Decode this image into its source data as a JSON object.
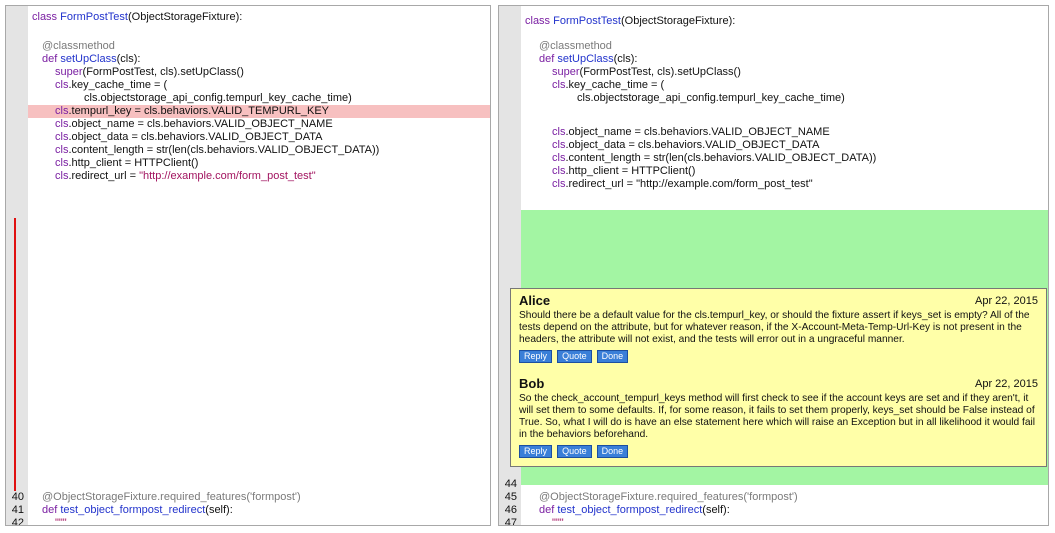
{
  "left": {
    "code": {
      "class_kw": "class",
      "class_name": "FormPostTest",
      "class_rest": "(ObjectStorageFixture):",
      "decorator": "@classmethod",
      "def_kw": "def",
      "setup_fn": "setUpClass",
      "setup_args": "(cls):",
      "super_kw": "super",
      "super_rest": "(FormPostTest, cls).setUpClass()",
      "cls": "cls",
      "key_cache": ".key_cache_time = (",
      "key_cache_cont": "cls.objectstorage_api_config.tempurl_key_cache_time)",
      "tempurl": ".tempurl_key = cls.behaviors.VALID_TEMPURL_KEY",
      "object_name": ".object_name = cls.behaviors.VALID_OBJECT_NAME",
      "object_data": ".object_data = cls.behaviors.VALID_OBJECT_DATA",
      "content_length": ".content_length = str(len(cls.behaviors.VALID_OBJECT_DATA))",
      "http_client": ".http_client = HTTPClient()",
      "redirect_url": ".redirect_url = ",
      "redirect_str": "\"http://example.com/form_post_test\"",
      "req_features": "@ObjectStorageFixture.required_features('formpost')",
      "test_fn": "test_object_formpost_redirect",
      "test_args": "(self):",
      "docstr": "\"\"\""
    },
    "line_numbers": [
      "40",
      "41",
      "42"
    ]
  },
  "right": {
    "line_numbers": [
      "44",
      "45",
      "46",
      "47"
    ]
  },
  "comments": [
    {
      "author": "Alice",
      "date": "Apr 22, 2015",
      "text": "Should there be a default value for the cls.tempurl_key, or should the fixture assert if keys_set is empty? All of the tests depend on the attribute, but for whatever reason, if the X-Account-Meta-Temp-Url-Key is not present in the headers, the attribute will not exist, and the tests will error out in a ungraceful manner."
    },
    {
      "author": "Bob",
      "date": "Apr 22, 2015",
      "text": "So the check_account_tempurl_keys method will first check to see if the account keys are set and if they aren't, it will set them to some defaults. If, for some reason, it fails to set them properly, keys_set should be False instead of True. So, what I will do is have an else statement here which will raise an Exception but in all likelihood it would fail in the behaviors beforehand."
    }
  ],
  "buttons": {
    "reply": "Reply",
    "quote": "Quote",
    "done": "Done"
  },
  "colors": {
    "deleted_line": "#f7c0c0",
    "added_block": "#a3f5a3",
    "comment_bg": "#ffffa8",
    "button": "#3a7fd8",
    "change_bar": "#e01010"
  }
}
